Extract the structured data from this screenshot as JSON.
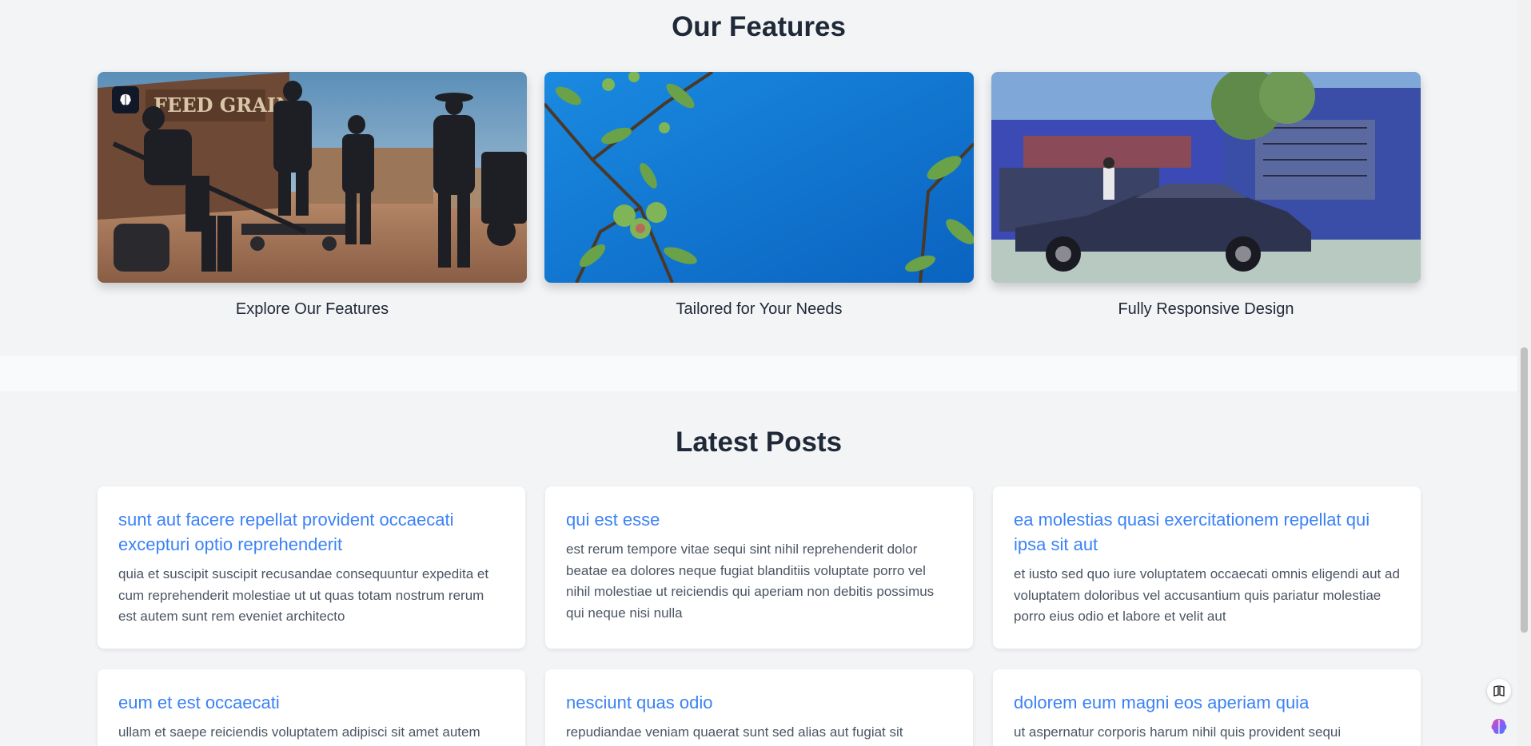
{
  "features": {
    "title": "Our Features",
    "cards": [
      {
        "label": "Explore Our Features",
        "image": "film-crew-western-town-photo"
      },
      {
        "label": "Tailored for Your Needs",
        "image": "fruit-branch-blue-sky-photo"
      },
      {
        "label": "Fully Responsive Design",
        "image": "vintage-car-street-photo"
      }
    ],
    "badge_icon": "brain-icon"
  },
  "posts": {
    "title": "Latest Posts",
    "items": [
      {
        "title": "sunt aut facere repellat provident occaecati excepturi optio reprehenderit",
        "body": "quia et suscipit suscipit recusandae consequuntur expedita et cum reprehenderit molestiae ut ut quas totam nostrum rerum est autem sunt rem eveniet architecto"
      },
      {
        "title": "qui est esse",
        "body": "est rerum tempore vitae sequi sint nihil reprehenderit dolor beatae ea dolores neque fugiat blanditiis voluptate porro vel nihil molestiae ut reiciendis qui aperiam non debitis possimus qui neque nisi nulla"
      },
      {
        "title": "ea molestias quasi exercitationem repellat qui ipsa sit aut",
        "body": "et iusto sed quo iure voluptatem occaecati omnis eligendi aut ad voluptatem doloribus vel accusantium quis pariatur molestiae porro eius odio et labore et velit aut"
      },
      {
        "title": "eum et est occaecati",
        "body": "ullam et saepe reiciendis voluptatem adipisci sit amet autem"
      },
      {
        "title": "nesciunt quas odio",
        "body": "repudiandae veniam quaerat sunt sed alias aut fugiat sit"
      },
      {
        "title": "dolorem eum magni eos aperiam quia",
        "body": "ut aspernatur corporis harum nihil quis provident sequi"
      }
    ]
  },
  "floating_buttons": [
    {
      "icon": "book-icon"
    },
    {
      "icon": "brain-gradient-icon"
    }
  ],
  "colors": {
    "accent": "#3b82f6",
    "background": "#f3f4f6",
    "heading": "#1f2937"
  }
}
